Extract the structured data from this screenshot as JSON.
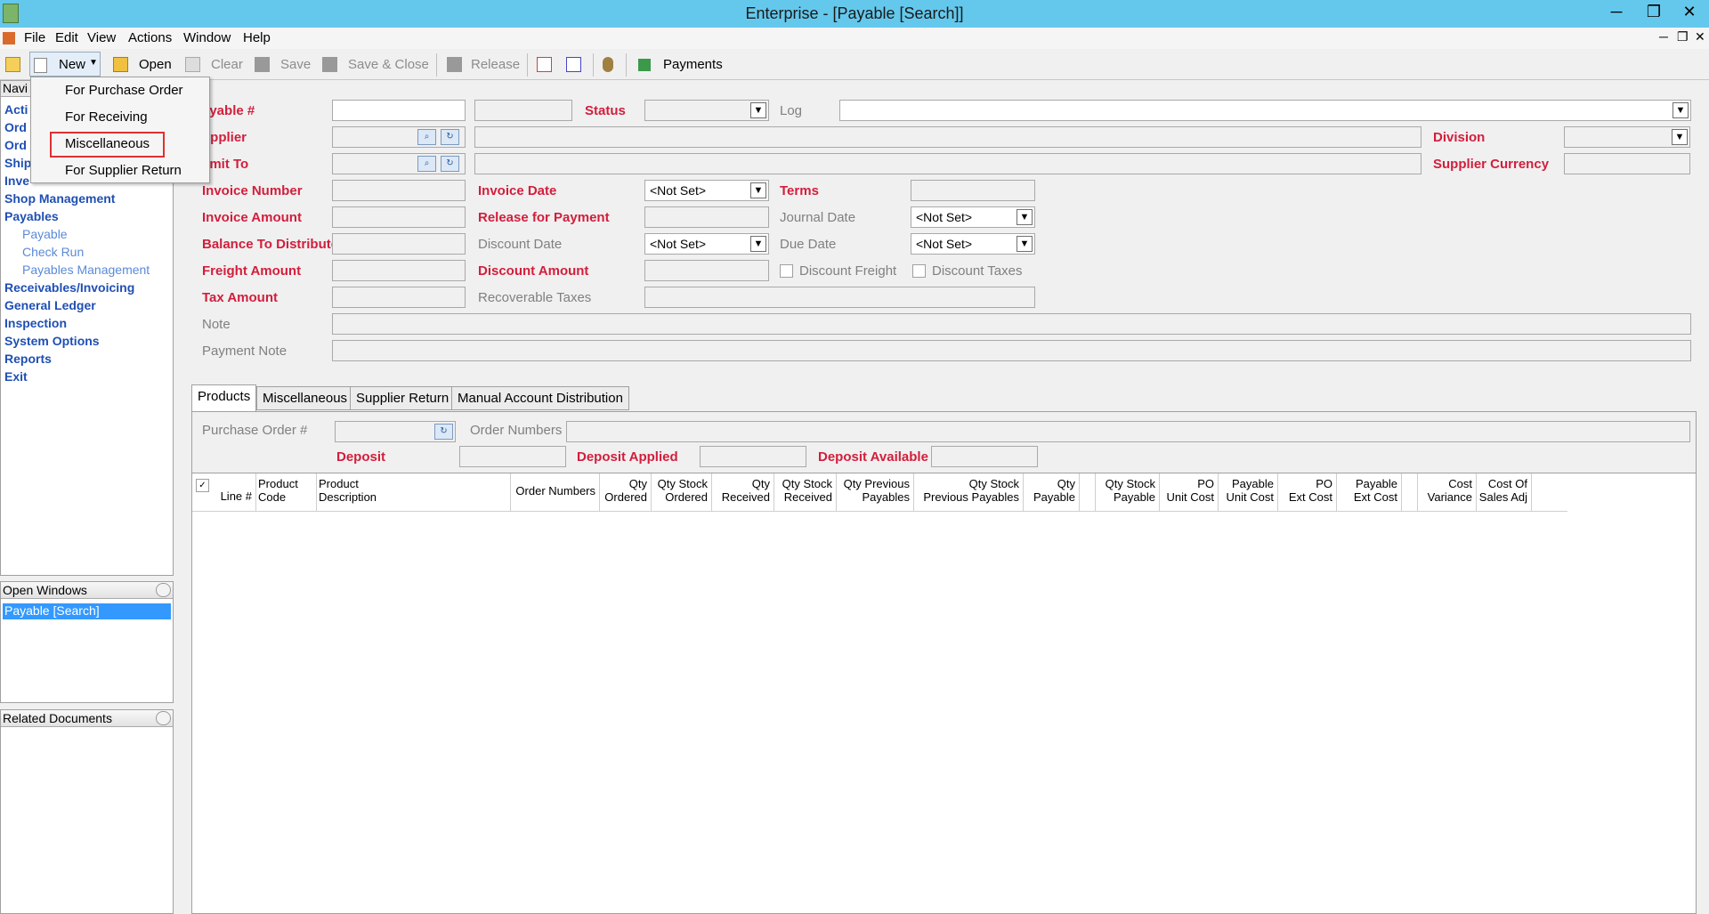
{
  "window": {
    "title": "Enterprise - [Payable [Search]]"
  },
  "menu": [
    "File",
    "Edit",
    "View",
    "Actions",
    "Window",
    "Help"
  ],
  "toolbar": {
    "new": "New",
    "open": "Open",
    "clear": "Clear",
    "save": "Save",
    "save_close": "Save & Close",
    "release": "Release",
    "payments": "Payments"
  },
  "dropdown": {
    "items": [
      "For Purchase Order",
      "For Receiving",
      "Miscellaneous",
      "For Supplier Return"
    ],
    "highlighted": "Miscellaneous"
  },
  "navigation": {
    "header": "Navi",
    "partial_items": [
      "Acti",
      "Ord",
      "Ord",
      "Ship",
      "Inve"
    ],
    "items": [
      "Shop Management",
      "Payables",
      "Receivables/Invoicing",
      "General Ledger",
      "Inspection",
      "System Options",
      "Reports",
      "Exit"
    ],
    "payables_sub": [
      "Payable",
      "Check Run",
      "Payables Management"
    ]
  },
  "open_windows": {
    "header": "Open Windows",
    "items": [
      "Payable [Search]"
    ]
  },
  "related_documents": {
    "header": "Related Documents"
  },
  "form": {
    "payable_no": "ayable #",
    "status": "Status",
    "log": "Log",
    "supplier": "upplier",
    "division": "Division",
    "remit_to": "emit To",
    "supplier_currency": "Supplier Currency",
    "invoice_number": "Invoice Number",
    "invoice_date": "Invoice Date",
    "invoice_date_value": "<Not Set>",
    "terms": "Terms",
    "invoice_amount": "Invoice Amount",
    "release_for_payment": "Release for Payment",
    "journal_date": "Journal Date",
    "journal_date_value": "<Not Set>",
    "balance_to_distribute": "Balance To Distribute",
    "discount_date": "Discount Date",
    "discount_date_value": "<Not Set>",
    "due_date": "Due Date",
    "due_date_value": "<Not Set>",
    "freight_amount": "Freight Amount",
    "discount_amount": "Discount Amount",
    "discount_freight": "Discount Freight",
    "discount_taxes": "Discount Taxes",
    "tax_amount": "Tax Amount",
    "recoverable_taxes": "Recoverable Taxes",
    "note": "Note",
    "payment_note": "Payment Note"
  },
  "tabs": [
    "Products",
    "Miscellaneous",
    "Supplier Return",
    "Manual Account Distribution"
  ],
  "products": {
    "purchase_order_no": "Purchase Order #",
    "order_numbers": "Order Numbers",
    "deposit": "Deposit",
    "deposit_applied": "Deposit Applied",
    "deposit_available": "Deposit Available"
  },
  "grid": {
    "columns": [
      [
        "Line #",
        ""
      ],
      [
        "Product",
        "Code"
      ],
      [
        "Product",
        "Description"
      ],
      [
        "Order Numbers",
        ""
      ],
      [
        "Qty",
        "Ordered"
      ],
      [
        "Qty Stock",
        "Ordered"
      ],
      [
        "Qty",
        "Received"
      ],
      [
        "Qty Stock",
        "Received"
      ],
      [
        "Qty Previous",
        "Payables"
      ],
      [
        "Qty Stock",
        "Previous Payables"
      ],
      [
        "Qty",
        "Payable"
      ],
      [
        "",
        ""
      ],
      [
        "Qty Stock",
        "Payable"
      ],
      [
        "PO",
        "Unit Cost"
      ],
      [
        "Payable",
        "Unit Cost"
      ],
      [
        "PO",
        "Ext Cost"
      ],
      [
        "Payable",
        "Ext Cost"
      ],
      [
        "",
        ""
      ],
      [
        "Cost",
        "Variance"
      ],
      [
        "Cost Of",
        "Sales Adj"
      ]
    ]
  }
}
